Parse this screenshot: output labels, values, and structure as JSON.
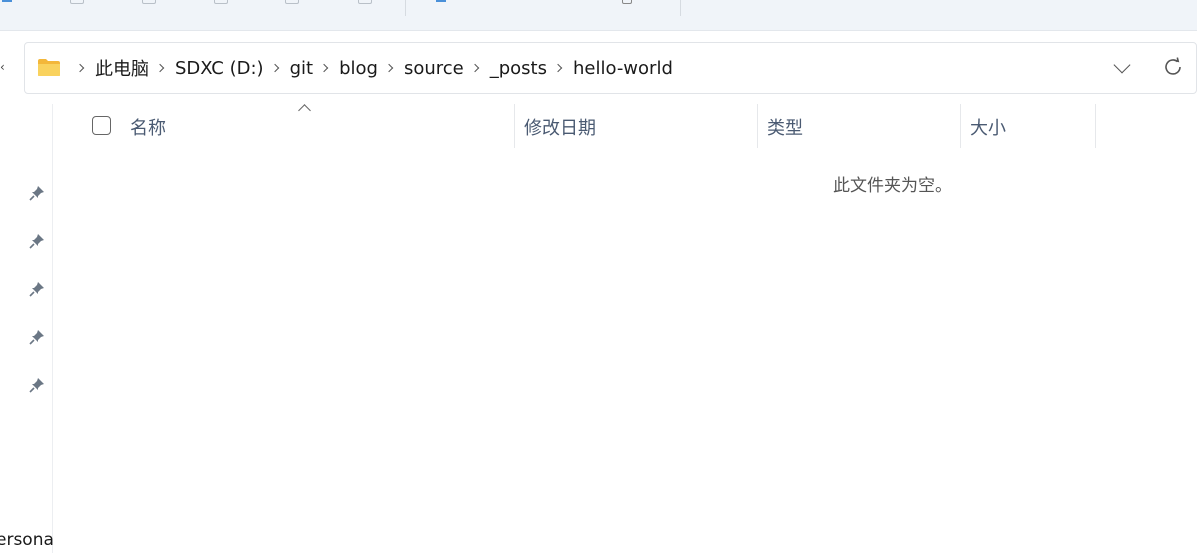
{
  "address": {
    "crumbs": [
      "此电脑",
      "SDXC (D:)",
      "git",
      "blog",
      "source",
      "_posts",
      "hello-world"
    ]
  },
  "columns": {
    "name": "名称",
    "modified": "修改日期",
    "type": "类型",
    "size": "大小"
  },
  "content": {
    "empty_message": "此文件夹为空。"
  },
  "sidebar": {
    "cut_label": "ersona"
  },
  "icons": {
    "folder": "folder-icon",
    "refresh": "refresh-icon",
    "pin": "pin-icon",
    "dropdown": "chevron-down-icon",
    "separator": "chevron-right-icon"
  },
  "colors": {
    "folder_yellow": "#f7c948",
    "header_text": "#4a5a72",
    "toolbar_bg": "#f0f4f9"
  }
}
